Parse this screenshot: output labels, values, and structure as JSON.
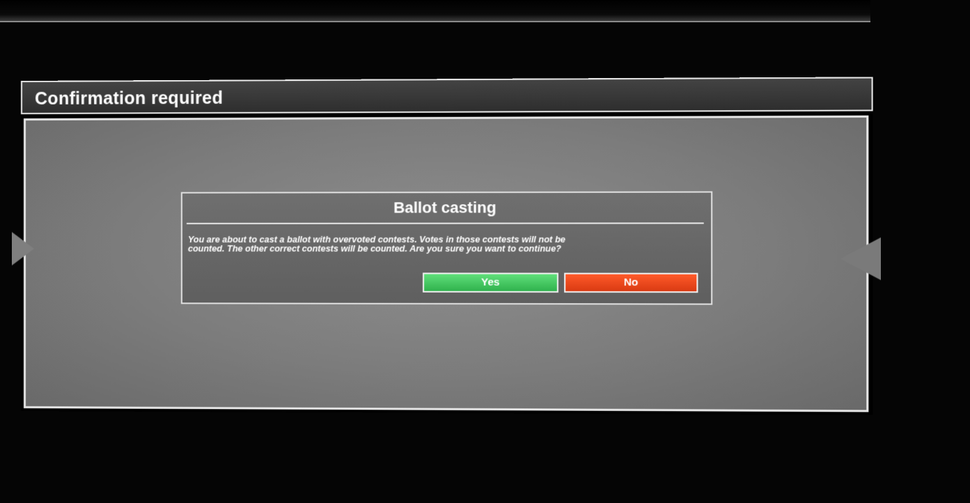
{
  "window": {
    "title": "Confirmation required"
  },
  "dialog": {
    "title": "Ballot casting",
    "message_line1": "You are about to cast a ballot with overvoted contests. Votes in those contests will not be",
    "message_line2": "counted. The other correct contests will be counted. Are you sure you want to continue?",
    "yes_label": "Yes",
    "no_label": "No"
  },
  "colors": {
    "yes_button": "#3cc45a",
    "no_button": "#e8461a",
    "panel": "#7c7c7c",
    "titlebar": "#383838"
  },
  "icons": {
    "left": "triangle-right-icon",
    "right": "triangle-left-icon"
  }
}
